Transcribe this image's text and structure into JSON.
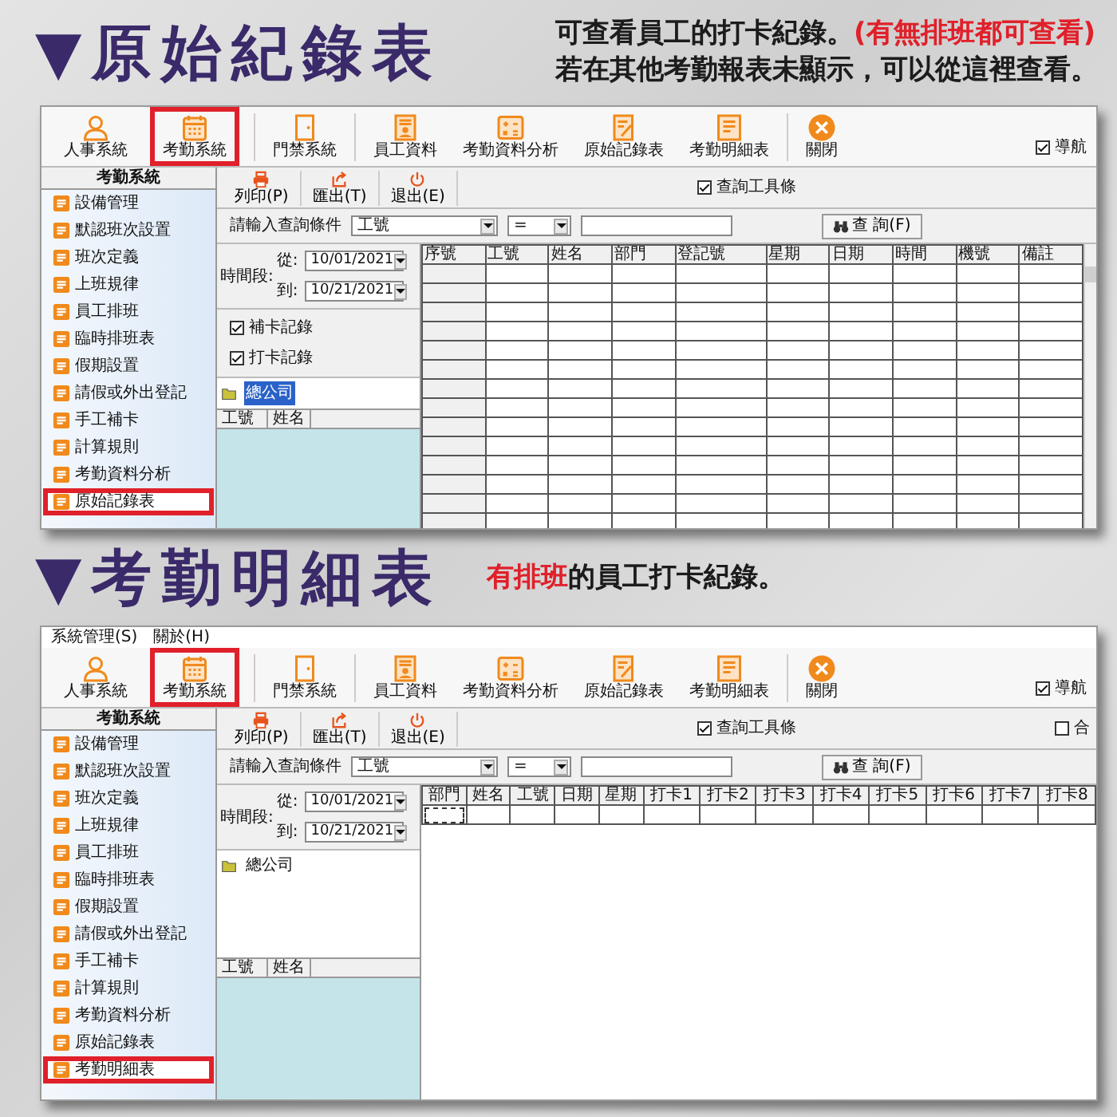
{
  "sections": [
    {
      "heading": "▼原始紀錄表",
      "description": [
        [
          {
            "text": "可查看員工的打卡紀錄。",
            "emphasis": false
          },
          {
            "text": "(有無排班都可查看)",
            "emphasis": true
          }
        ],
        [
          {
            "text": "若在其他考勤報表未顯示，可以從這裡查看。",
            "emphasis": false
          }
        ]
      ],
      "window": {
        "toolbar": [
          {
            "label": "人事系統",
            "kind": "person",
            "highlighted": false
          },
          {
            "label": "考勤系統",
            "kind": "calendar",
            "highlighted": true
          },
          {
            "label": "門禁系統",
            "kind": "door",
            "highlighted": false
          },
          {
            "label": "員工資料",
            "kind": "profile",
            "highlighted": false
          },
          {
            "label": "考勤資料分析",
            "kind": "calculator",
            "highlighted": false
          },
          {
            "label": "原始記錄表",
            "kind": "edit",
            "highlighted": false
          },
          {
            "label": "考勤明細表",
            "kind": "report",
            "highlighted": false
          },
          {
            "label": "關閉",
            "kind": "close",
            "highlighted": false
          }
        ],
        "navigation": {
          "label": "導航",
          "checked": true
        },
        "sidebar": {
          "title": "考勤系統",
          "items": [
            {
              "label": "設備管理",
              "highlighted": false
            },
            {
              "label": "默認班次設置",
              "highlighted": false
            },
            {
              "label": "班次定義",
              "highlighted": false
            },
            {
              "label": "上班規律",
              "highlighted": false
            },
            {
              "label": "員工排班",
              "highlighted": false
            },
            {
              "label": "臨時排班表",
              "highlighted": false
            },
            {
              "label": "假期設置",
              "highlighted": false
            },
            {
              "label": "請假或外出登記",
              "highlighted": false
            },
            {
              "label": "手工補卡",
              "highlighted": false
            },
            {
              "label": "計算規則",
              "highlighted": false
            },
            {
              "label": "考勤資料分析",
              "highlighted": false
            },
            {
              "label": "原始記錄表",
              "highlighted": true
            }
          ]
        },
        "actions": [
          {
            "label": "列印(P)",
            "kind": "print"
          },
          {
            "label": "匯出(T)",
            "kind": "export"
          },
          {
            "label": "退出(E)",
            "kind": "exit"
          }
        ],
        "options": [
          {
            "label": "查詢工具條",
            "checked": true
          }
        ],
        "query": {
          "label": "請輸入查詢條件",
          "field": "工號",
          "operator": "=",
          "button": "查 詢(F)"
        },
        "period": {
          "label": "時間段:",
          "from_label": "從:",
          "from": "10/01/2021",
          "to_label": "到:",
          "to": "10/21/2021"
        },
        "record_types": [
          {
            "label": "補卡記錄",
            "checked": true
          },
          {
            "label": "打卡記錄",
            "checked": true
          }
        ],
        "tree": [
          {
            "label": "總公司",
            "selected": true
          }
        ],
        "employee_columns": [
          "工號",
          "姓名"
        ],
        "table": {
          "numbered": true,
          "columns": [
            "序號",
            "工號",
            "姓名",
            "部門",
            "登記號",
            "星期",
            "日期",
            "時間",
            "機號",
            "備註"
          ]
        }
      }
    },
    {
      "heading": "▼考勤明細表",
      "description": [
        [
          {
            "text": "有排班",
            "emphasis": true
          },
          {
            "text": "的員工打卡紀錄。",
            "emphasis": false
          }
        ]
      ],
      "window": {
        "menu": [
          "系統管理(S)",
          "關於(H)"
        ],
        "toolbar": [
          {
            "label": "人事系統",
            "kind": "person",
            "highlighted": false
          },
          {
            "label": "考勤系統",
            "kind": "calendar",
            "highlighted": true
          },
          {
            "label": "門禁系統",
            "kind": "door",
            "highlighted": false
          },
          {
            "label": "員工資料",
            "kind": "profile",
            "highlighted": false
          },
          {
            "label": "考勤資料分析",
            "kind": "calculator",
            "highlighted": false
          },
          {
            "label": "原始記錄表",
            "kind": "edit",
            "highlighted": false
          },
          {
            "label": "考勤明細表",
            "kind": "report",
            "highlighted": false
          },
          {
            "label": "關閉",
            "kind": "close",
            "highlighted": false
          }
        ],
        "navigation": {
          "label": "導航",
          "checked": true
        },
        "sidebar": {
          "title": "考勤系統",
          "items": [
            {
              "label": "設備管理",
              "highlighted": false
            },
            {
              "label": "默認班次設置",
              "highlighted": false
            },
            {
              "label": "班次定義",
              "highlighted": false
            },
            {
              "label": "上班規律",
              "highlighted": false
            },
            {
              "label": "員工排班",
              "highlighted": false
            },
            {
              "label": "臨時排班表",
              "highlighted": false
            },
            {
              "label": "假期設置",
              "highlighted": false
            },
            {
              "label": "請假或外出登記",
              "highlighted": false
            },
            {
              "label": "手工補卡",
              "highlighted": false
            },
            {
              "label": "計算規則",
              "highlighted": false
            },
            {
              "label": "考勤資料分析",
              "highlighted": false
            },
            {
              "label": "原始記錄表",
              "highlighted": false
            },
            {
              "label": "考勤明細表",
              "highlighted": true
            }
          ]
        },
        "actions": [
          {
            "label": "列印(P)",
            "kind": "print"
          },
          {
            "label": "匯出(T)",
            "kind": "export"
          },
          {
            "label": "退出(E)",
            "kind": "exit"
          }
        ],
        "options": [
          {
            "label": "查詢工具條",
            "checked": true
          },
          {
            "label": "合",
            "checked": false
          }
        ],
        "query": {
          "label": "請輸入查詢條件",
          "field": "工號",
          "operator": "=",
          "button": "查 詢(F)"
        },
        "period": {
          "label": "時間段:",
          "from_label": "從:",
          "from": "10/01/2021",
          "to_label": "到:",
          "to": "10/21/2021"
        },
        "tree": [
          {
            "label": "總公司",
            "selected": false
          }
        ],
        "employee_columns": [
          "工號",
          "姓名"
        ],
        "table": {
          "numbered": false,
          "columns": [
            "部門",
            "姓名",
            "工號",
            "日期",
            "星期",
            "打卡1",
            "打卡2",
            "打卡3",
            "打卡4",
            "打卡5",
            "打卡6",
            "打卡7",
            "打卡8"
          ]
        }
      }
    }
  ]
}
